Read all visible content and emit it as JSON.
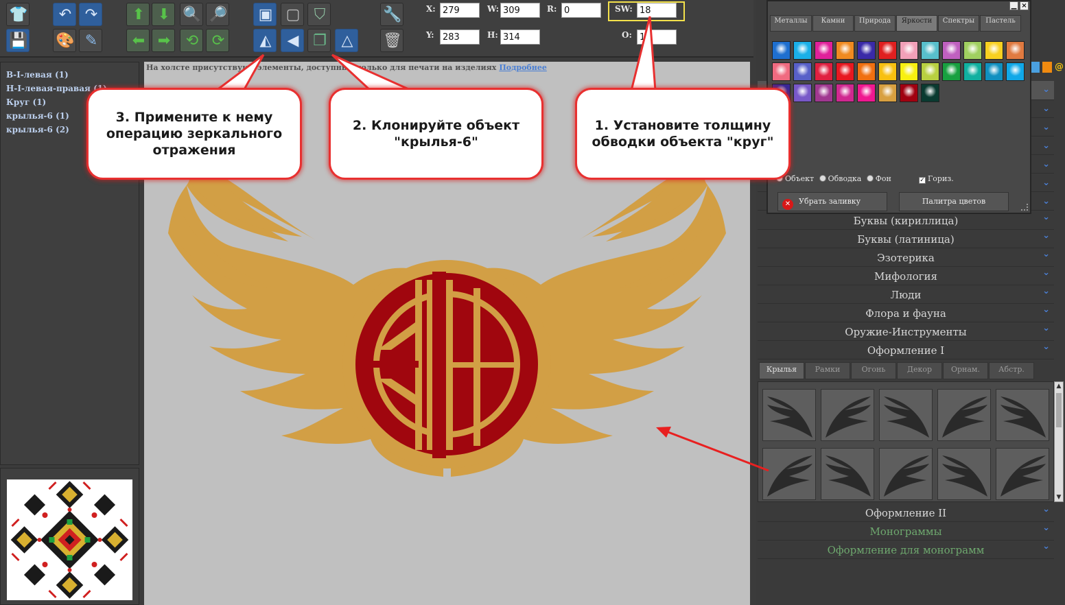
{
  "toolbar": {
    "labels": {
      "x": "X:",
      "y": "Y:",
      "w": "W:",
      "h": "H:",
      "r": "R:",
      "o": "O:",
      "sw": "SW:"
    },
    "values": {
      "x": "279",
      "y": "283",
      "w": "309",
      "h": "314",
      "r": "0",
      "o": "1",
      "sw": "18"
    },
    "icons": [
      "tshirt-icon",
      "undo-icon",
      "redo-icon",
      "move-up-icon",
      "move-down-icon",
      "zoom-in-icon",
      "zoom-out-icon",
      "bring-front-icon",
      "send-back-icon",
      "center-icon",
      "tools-icon",
      "save-icon",
      "palette-icon",
      "edit-pencil-icon",
      "move-left-icon",
      "move-right-icon",
      "rotate-ccw-icon",
      "rotate-cw-icon",
      "flip-vertical-icon",
      "flip-horizontal-icon",
      "clone-icon",
      "triangle-icon",
      "trash-icon"
    ]
  },
  "layers": {
    "items": [
      "В-І-левая (1)",
      "Н-І-левая-правая (1)",
      "Круг (1)",
      "крылья-6 (1)",
      "крылья-6 (2)"
    ]
  },
  "canvas": {
    "notice": "На холсте присутствуют элементы, доступные только для печати на изделиях",
    "notice_link": "Подробнее",
    "colors": {
      "wings": "#d29f45",
      "circle": "#a0060e",
      "background": "#c0c0c0"
    }
  },
  "color_panel": {
    "tabs": [
      "Металлы",
      "Камни",
      "Природа",
      "Яркости",
      "Спектры",
      "Пастель"
    ],
    "active_tab": "Яркости",
    "swatches": [
      "#1e6fd0",
      "#1ab0e8",
      "#e0209a",
      "#f08a20",
      "#3a2aa8",
      "#e02020",
      "#f2a0b8",
      "#58c0cc",
      "#c060c0",
      "#a0d060",
      "#f8d020",
      "#e07a40",
      "#f06a80",
      "#5860c8",
      "#e02040",
      "#e81820",
      "#f07010",
      "#f8c010",
      "#f8f010",
      "#b8d040",
      "#18a040",
      "#10b0a0",
      "#1090c0",
      "#10a8e8",
      "#3a2898",
      "#7858c8",
      "#a03890",
      "#d02890",
      "#f01890",
      "#d8a040",
      "#a00010",
      "#0a3a30"
    ],
    "radio_labels": [
      "Объект",
      "Обводка",
      "Фон"
    ],
    "checkbox_label": "Гориз.",
    "remove_fill_label": "Убрать заливку",
    "palette_label": "Палитра цветов"
  },
  "categories": {
    "upper": [
      "Буквы (кириллица)",
      "Буквы (латиница)",
      "Эзотерика",
      "Мифология",
      "Люди",
      "Флора и фауна",
      "Оружие-Инструменты",
      "Оформление I"
    ],
    "lower": [
      "Оформление II",
      "Монограммы",
      "Оформление для монограмм"
    ]
  },
  "wing_tabs": [
    "Крылья",
    "Рамки",
    "Огонь",
    "Декор",
    "Орнам.",
    "Абстр."
  ],
  "callouts": {
    "step1": "1. Установите толщину обводки объекта \"круг\"",
    "step2": "2. Клонируйте объект \"крылья-6\"",
    "step3": "3. Примените к нему операцию зеркального отражения"
  }
}
